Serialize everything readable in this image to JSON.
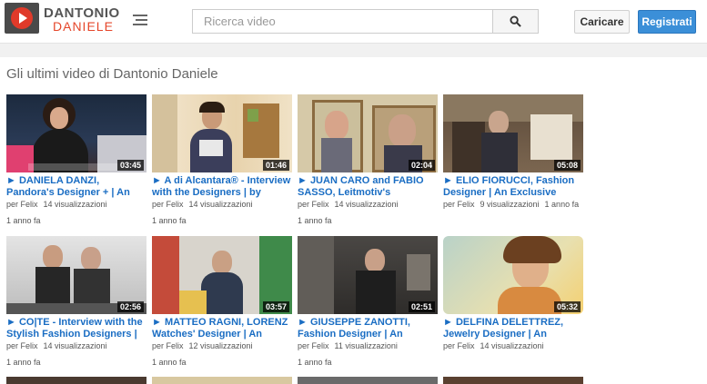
{
  "header": {
    "brand_line1": "DANTONIO",
    "brand_line2": "DANIELE",
    "search_placeholder": "Ricerca video",
    "upload_label": "Caricare",
    "register_label": "Registrati"
  },
  "main": {
    "section_title": "Gli ultimi video di Dantonio Daniele",
    "videos": [
      {
        "title": "► DANIELA DANZI, Pandora's Designer + | An Exclusive",
        "author": "per Felix",
        "views": "14 visualizzazioni",
        "date": "1 anno fa",
        "duration": "03:45"
      },
      {
        "title": "► A di Alcantara® - Interview with the Designers | by",
        "author": "per Felix",
        "views": "14 visualizzazioni",
        "date": "1 anno fa",
        "duration": "01:46"
      },
      {
        "title": "► JUAN CARO and FABIO SASSO, Leitmotiv's Designers |",
        "author": "per Felix",
        "views": "14 visualizzazioni",
        "date": "1 anno fa",
        "duration": "02:04"
      },
      {
        "title": "► ELIO FIORUCCI, Fashion Designer | An Exclusive",
        "author": "per Felix",
        "views": "9 visualizzazioni",
        "date": "1 anno fa",
        "duration": "05:08"
      },
      {
        "title": "► CO|TE - Interview with the Stylish Fashion Designers | by",
        "author": "per Felix",
        "views": "14 visualizzazioni",
        "date": "1 anno fa",
        "duration": "02:56"
      },
      {
        "title": "► MATTEO RAGNI, LORENZ Watches' Designer | An",
        "author": "per Felix",
        "views": "12 visualizzazioni",
        "date": "1 anno fa",
        "duration": "03:57"
      },
      {
        "title": "► GIUSEPPE ZANOTTI, Fashion Designer | An",
        "author": "per Felix",
        "views": "11 visualizzazioni",
        "date": "1 anno fa",
        "duration": "02:51"
      },
      {
        "title": "► DELFINA DELETTREZ, Jewelry Designer | An",
        "author": "per Felix",
        "views": "14 visualizzazioni",
        "date": "",
        "duration": "05:32"
      }
    ]
  },
  "colors": {
    "accent": "#3b8fd8",
    "link": "#1a6dc3",
    "brand_red": "#e5462a"
  }
}
